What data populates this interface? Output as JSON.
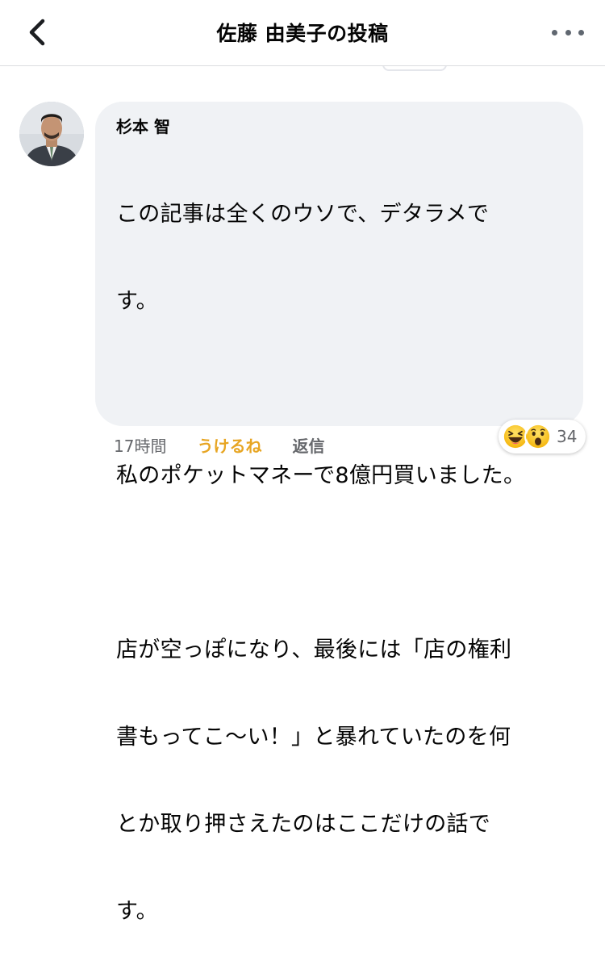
{
  "header": {
    "title": "佐藤 由美子の投稿",
    "back_icon": "chevron-left-icon",
    "more_icon": "more-horizontal-icon"
  },
  "comment": {
    "author": "杉本 智",
    "paragraphs": [
      [
        "この記事は全くのウソで、デタラメで",
        "す。"
      ],
      [
        "私のポケットマネーで8億円買いました。"
      ],
      [
        "店が空っぽになり、最後には「店の権利",
        "書もってこ〜い！」と暴れていたのを何",
        "とか取り押さえたのはここだけの話で",
        "す。"
      ]
    ],
    "time": "17時間",
    "like_label": "うけるね",
    "reply_label": "返信",
    "reactions": {
      "icons": [
        "laughing-emoji-icon",
        "wow-emoji-icon"
      ],
      "count": "34"
    }
  },
  "colors": {
    "bubble": "#f0f2f5",
    "like_active": "#e7a522",
    "muted": "#65676b"
  }
}
